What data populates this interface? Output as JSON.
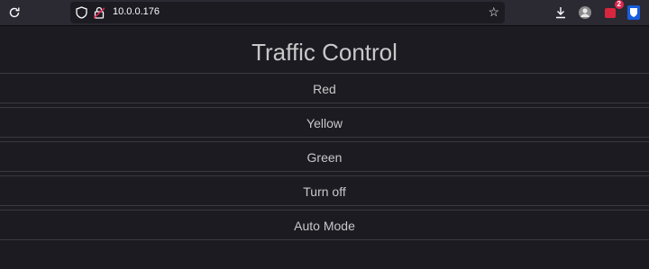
{
  "browser": {
    "url": "10.0.0.176",
    "extension_badge_count": "2",
    "icons": {
      "reload": "reload-icon",
      "tracking": "shield-icon",
      "lock": "lock-warning-icon",
      "bookmark": "star-icon",
      "downloads": "download-icon",
      "avatar": "avatar-icon",
      "extension": "extension-icon",
      "password_manager": "bitwarden-icon"
    }
  },
  "page": {
    "title": "Traffic Control",
    "buttons": [
      {
        "label": "Red"
      },
      {
        "label": "Yellow"
      },
      {
        "label": "Green"
      },
      {
        "label": "Turn off"
      },
      {
        "label": "Auto Mode"
      }
    ]
  },
  "colors": {
    "background": "#1c1b22",
    "toolbar": "#2b2a33",
    "text": "#c8c8c8",
    "divider": "#3a3a40",
    "badge": "#e22850"
  }
}
